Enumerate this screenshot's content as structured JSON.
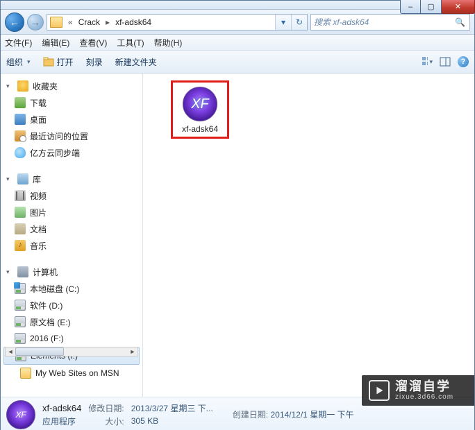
{
  "window": {
    "min_label": "–",
    "max_label": "▢",
    "close_label": "✕"
  },
  "nav": {
    "back_glyph": "←",
    "fwd_glyph": "→",
    "dropdown_glyph": "▾",
    "refresh_glyph": "↻"
  },
  "breadcrumbs": {
    "sep0": "«",
    "item0": "Crack",
    "sep": "▸",
    "item1": "xf-adsk64"
  },
  "search": {
    "placeholder": "搜索 xf-adsk64",
    "icon": "🔍"
  },
  "menu": {
    "file": "文件(F)",
    "edit": "编辑(E)",
    "view": "查看(V)",
    "tools": "工具(T)",
    "help": "帮助(H)"
  },
  "toolbar": {
    "organize": "组织",
    "open": "打开",
    "burn": "刻录",
    "newfolder": "新建文件夹"
  },
  "sidebar": {
    "favorites": "收藏夹",
    "downloads": "下载",
    "desktop": "桌面",
    "recent": "最近访问的位置",
    "cloud": "亿方云同步端",
    "libraries": "库",
    "videos": "视频",
    "pictures": "图片",
    "documents": "文档",
    "music": "音乐",
    "computer": "计算机",
    "drive_c": "本地磁盘 (C:)",
    "drive_d": "软件 (D:)",
    "drive_e": "原文档 (E:)",
    "drive_f": "2016 (F:)",
    "drive_i": "Elements (I:)",
    "webfolder": "My Web Sites on MSN"
  },
  "content": {
    "file0_label": "xf-adsk64",
    "file0_icon_text": "XF"
  },
  "details": {
    "name": "xf-adsk64",
    "type": "应用程序",
    "mod_label": "修改日期:",
    "mod_value": "2013/3/27 星期三 下...",
    "create_label": "创建日期:",
    "create_value": "2014/12/1 星期一 下午",
    "size_label": "大小:",
    "size_value": "305 KB",
    "thumb_text": "XF"
  },
  "watermark": {
    "line1": "溜溜自学",
    "line2": "zixue.3d66.com"
  }
}
